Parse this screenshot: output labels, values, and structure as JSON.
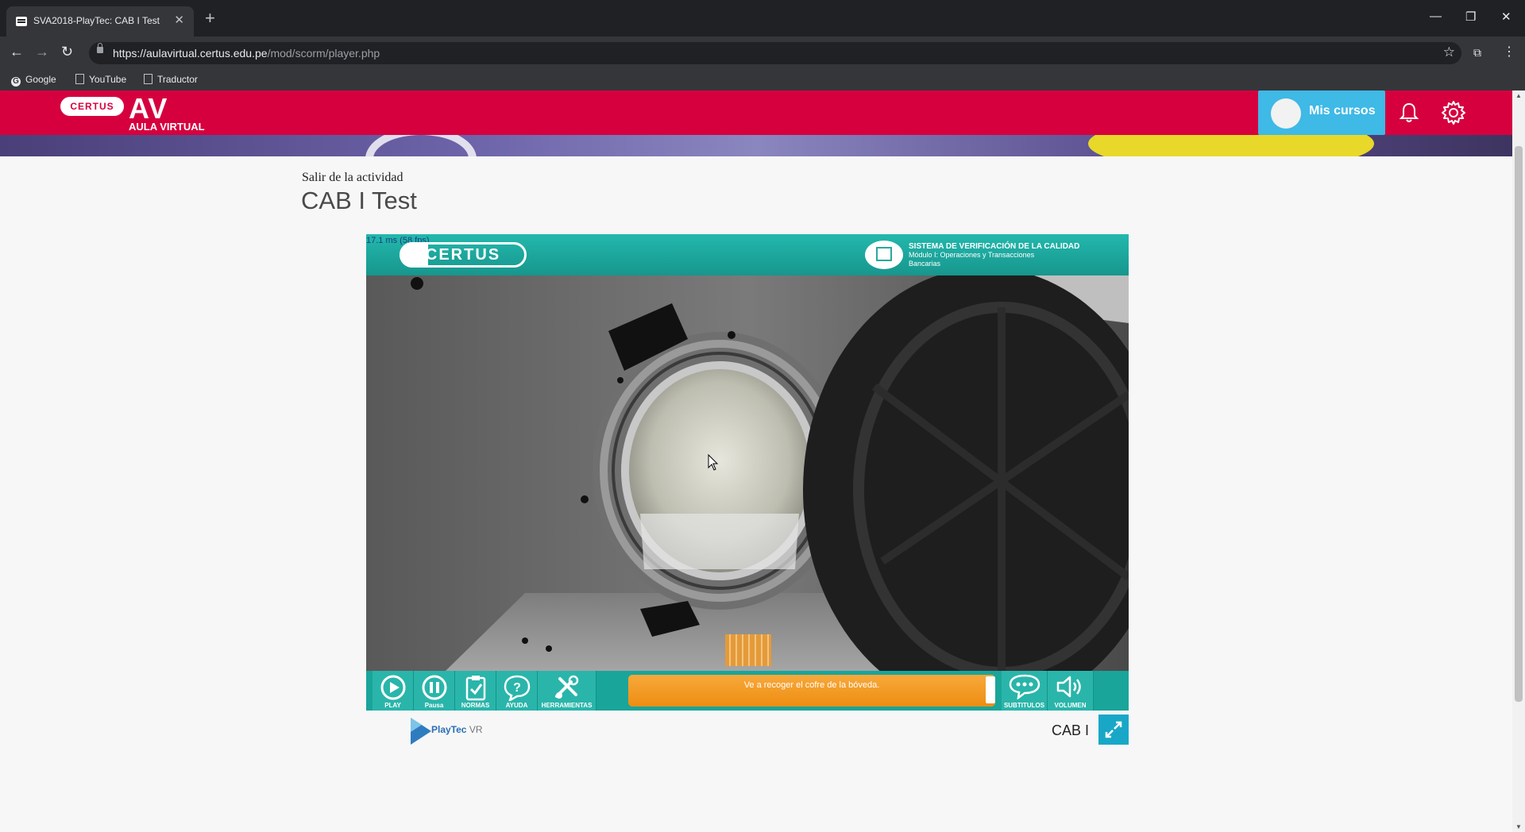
{
  "browser": {
    "tab_title": "SVA2018-PlayTec: CAB I Test",
    "url_host": "https://aulavirtual.certus.edu.pe",
    "url_path": "/mod/scorm/player.php",
    "bookmarks": [
      "Google",
      "YouTube",
      "Traductor"
    ]
  },
  "header": {
    "logo_pill": "CERTUS",
    "logo_av": "AV",
    "logo_sub": "AULA VIRTUAL",
    "mis_cursos": "Mis cursos",
    "brand_color": "#d6003f",
    "button_color": "#3fb9e6"
  },
  "page": {
    "exit_link": "Salir de la actividad",
    "title": "CAB I Test"
  },
  "player": {
    "fps": "17.1 ms (58 fps)",
    "logo": "CERTUS",
    "system_line1": "SISTEMA DE VERIFICACIÓN DE LA CALIDAD",
    "system_line2": "Módulo I: Operaciones y Transacciones",
    "system_line3": "Bancarias",
    "subtitle": "Ve a recoger el cofre de la bóveda.",
    "controls": {
      "play": "PLAY",
      "pausa": "Pausa",
      "normas": "NORMAS",
      "ayuda": "AYUDA",
      "herramientas": "HERRAMIENTAS",
      "subtitulos": "SUBTITULOS",
      "volumen": "VOLUMEN"
    },
    "teal_color": "#19a59a",
    "orange_color": "#f29a22"
  },
  "footer": {
    "playtec": "PlayTec",
    "vr": "VR",
    "cab_label": "CAB I"
  }
}
